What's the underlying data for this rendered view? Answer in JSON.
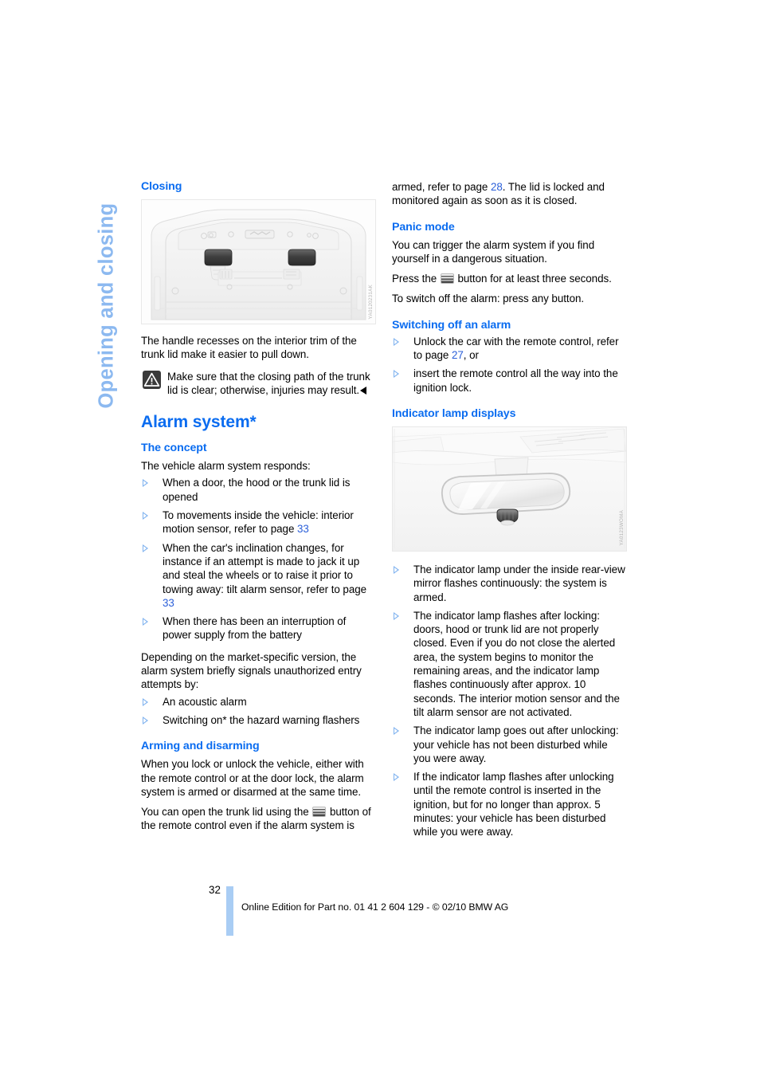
{
  "document": {
    "side_tab_title": "Opening and closing",
    "page_number": "32",
    "footer_text": "Online Edition for Part no. 01 41 2 604 129 - © 02/10 BMW AG",
    "accent_heading_color": "#0A6CF0",
    "side_tab_color": "#8CB9F0",
    "bullet_color": "#7FB2EF",
    "page_ref_color": "#2B5FD9",
    "margin_bar_color": "#A9CDF4"
  },
  "left_column": {
    "closing": {
      "heading": "Closing",
      "figure": {
        "name": "trunk-lid-interior-trim",
        "code": "YA0120231AK"
      },
      "body": "The handle recesses on the interior trim of the trunk lid make it easier to pull down.",
      "warning": {
        "icon": "warning-triangle-icon",
        "text": "Make sure that the closing path of the trunk lid is clear; otherwise, injuries may result.",
        "end_marker": "◄"
      }
    },
    "alarm_system": {
      "heading": "Alarm system*",
      "concept": {
        "heading": "The concept",
        "intro": "The vehicle alarm system responds:",
        "bullets": [
          {
            "text_before": "When a door, the hood or the trunk lid is opened",
            "page_ref": "",
            "text_after": ""
          },
          {
            "text_before": "To movements inside the vehicle: interior motion sensor, refer to page ",
            "page_ref": "33",
            "text_after": ""
          },
          {
            "text_before": "When the car's inclination changes, for instance if an attempt is made to jack it up and steal the wheels or to raise it prior to towing away: tilt alarm sensor, refer to page ",
            "page_ref": "33",
            "text_after": ""
          },
          {
            "text_before": "When there has been an interruption of power supply from the battery",
            "page_ref": "",
            "text_after": ""
          }
        ],
        "market_note": "Depending on the market-specific version, the alarm system briefly signals unauthorized entry attempts by:",
        "signal_bullets": [
          {
            "text_before": "An acoustic alarm",
            "page_ref": "",
            "text_after": ""
          },
          {
            "text_before": "Switching on* the hazard warning flashers",
            "page_ref": "",
            "text_after": ""
          }
        ]
      },
      "arming": {
        "heading": "Arming and disarming",
        "paragraph_1": "When you lock or unlock the vehicle, either with the remote control or at the door lock, the alarm system is armed or disarmed at the same time.",
        "paragraph_2_before": "You can open the trunk lid using the ",
        "paragraph_2_icon": "trunk-release-button-icon",
        "paragraph_2_after": " button of the remote control even if the alarm system is"
      }
    }
  },
  "right_column": {
    "continued": {
      "text_before": "armed, refer to page ",
      "page_ref": "28",
      "text_after": ". The lid is locked and monitored again as soon as it is closed."
    },
    "panic_mode": {
      "heading": "Panic mode",
      "paragraph_1": "You can trigger the alarm system if you find yourself in a dangerous situation.",
      "paragraph_2_before": "Press the ",
      "paragraph_2_icon": "trunk-release-button-icon",
      "paragraph_2_after": " button for at least three seconds.",
      "paragraph_3": "To switch off the alarm: press any button."
    },
    "switching_off": {
      "heading": "Switching off an alarm",
      "bullets": [
        {
          "text_before": "Unlock the car with the remote control, refer to page ",
          "page_ref": "27",
          "text_after": ", or"
        },
        {
          "text_before": "insert the remote control all the way into the ignition lock.",
          "page_ref": "",
          "text_after": ""
        }
      ]
    },
    "indicator_lamp": {
      "heading": "Indicator lamp displays",
      "figure": {
        "name": "inside-rear-view-mirror",
        "code": "YA0123WOMA"
      },
      "bullets": [
        {
          "text_before": "The indicator lamp under the inside rear-view mirror flashes continuously: the system is armed.",
          "page_ref": "",
          "text_after": ""
        },
        {
          "text_before": "The indicator lamp flashes after locking: doors, hood or trunk lid are not properly closed. Even if you do not close the alerted area, the system begins to monitor the remaining areas, and the indicator lamp flashes continuously after approx. 10 seconds. The interior motion sensor and the tilt alarm sensor are not activated.",
          "page_ref": "",
          "text_after": ""
        },
        {
          "text_before": "The indicator lamp goes out after unlocking: your vehicle has not been disturbed while you were away.",
          "page_ref": "",
          "text_after": ""
        },
        {
          "text_before": "If the indicator lamp flashes after unlocking until the remote control is inserted in the ignition, but for no longer than approx. 5 minutes: your vehicle has been disturbed while you were away.",
          "page_ref": "",
          "text_after": ""
        }
      ]
    }
  }
}
